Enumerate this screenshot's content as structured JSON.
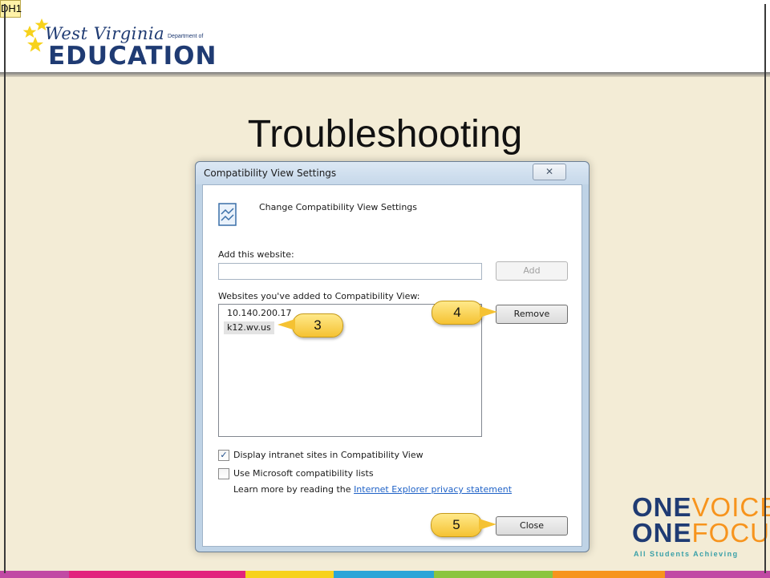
{
  "slide": {
    "tag": "DH1",
    "title": "Troubleshooting",
    "footer_colors": [
      "#c14aa4",
      "#e2237d",
      "#f7d21b",
      "#2aa5d8",
      "#8bc53f",
      "#f7941d",
      "#c14aa4"
    ]
  },
  "logo_wv": {
    "script": "West Virginia",
    "dept": "Department of",
    "education": "EDUCATION",
    "color": "#1f3b73",
    "star_color": "#f7d21b"
  },
  "logo_onevoice": {
    "line1_a": "ONE",
    "line1_b": "VOICE",
    "line2_a": "ONE",
    "line2_b": "FOCUS",
    "tagline": "All Students Achieving"
  },
  "dialog": {
    "title": "Compatibility View Settings",
    "close_glyph": "✕",
    "icon": "compat-view-icon",
    "header": "Change Compatibility View Settings",
    "add_label": "Add this website:",
    "add_value": "",
    "add_button": "Add",
    "list_label": "Websites you've added to Compatibility View:",
    "websites": [
      "10.140.200.17",
      "k12.wv.us"
    ],
    "remove_button": "Remove",
    "check1_label": "Display intranet sites in Compatibility View",
    "check1_checked": "✓",
    "check2_label": "Use Microsoft compatibility lists",
    "learn_prefix": "Learn more by reading the",
    "learn_link": "Internet Explorer privacy statement",
    "close_button": "Close"
  },
  "callouts": {
    "c3": "3",
    "c4": "4",
    "c5": "5"
  }
}
